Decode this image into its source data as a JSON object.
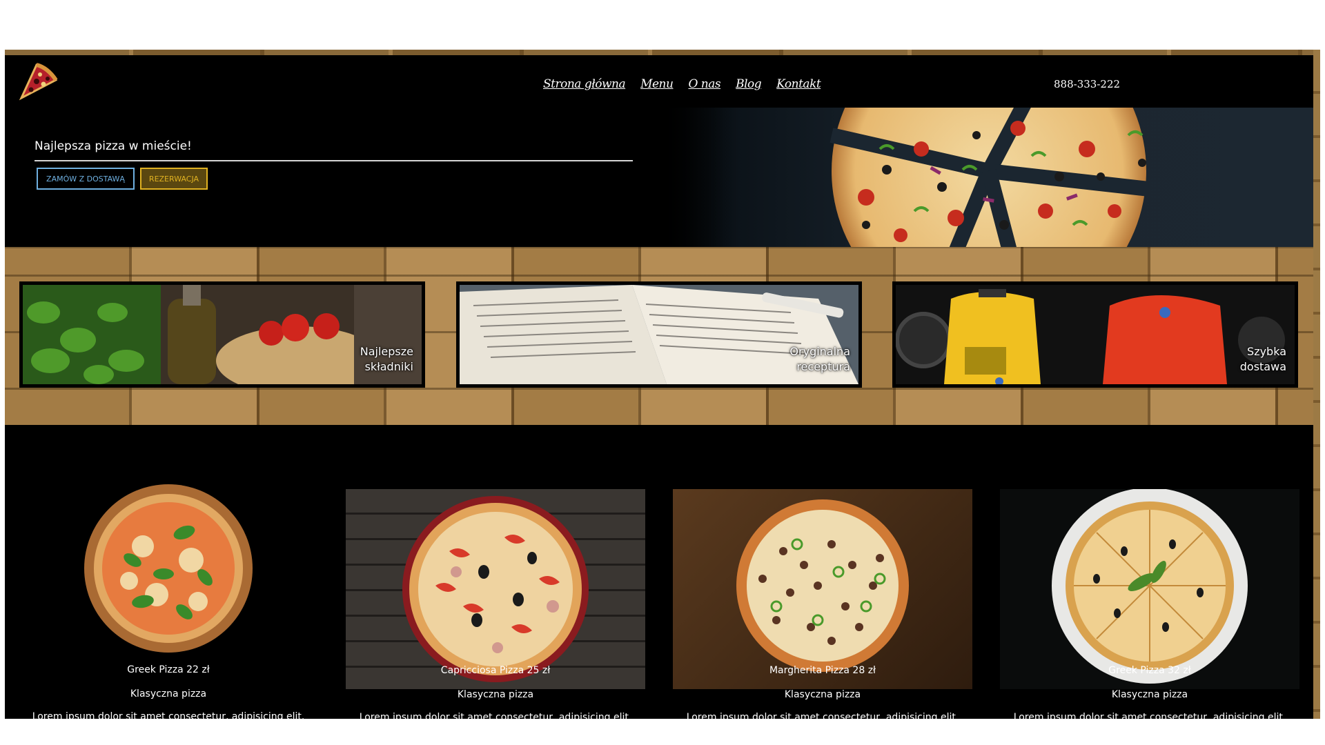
{
  "header": {
    "nav": [
      "Strona główna",
      "Menu",
      "O nas",
      "Blog",
      "Kontakt"
    ],
    "phone": "888-333-222"
  },
  "hero": {
    "title": "Najlepsza pizza w mieście!",
    "order_button": "ZAMÓW Z DOSTAWĄ",
    "reserve_button": "REZERWACJA"
  },
  "features": [
    {
      "label_line1": "Najlepsze",
      "label_line2": "składniki"
    },
    {
      "label_line1": "Oryginalna",
      "label_line2": "receptura"
    },
    {
      "label_line1": "Szybka",
      "label_line2": "dostawa"
    }
  ],
  "menu": [
    {
      "name": "Greek Pizza 22 zł",
      "type": "Klasyczna pizza",
      "desc": "Lorem ipsum dolor sit amet consectetur, adipisicing elit. Soluta, aliquid?"
    },
    {
      "name": "Capricciosa Pizza 25 zł",
      "type": "Klasyczna pizza",
      "desc": "Lorem ipsum dolor sit amet consectetur, adipisicing elit. Soluta, aliquid?"
    },
    {
      "name": "Margherita Pizza 28 zł",
      "type": "Klasyczna pizza",
      "desc": "Lorem ipsum dolor sit amet consectetur, adipisicing elit. Soluta, aliquid?"
    },
    {
      "name": "Greek Pizza 32 zł",
      "type": "Klasyczna pizza",
      "desc": "Lorem ipsum dolor sit amet consectetur, adipisicing elit. Soluta, aliquid?"
    }
  ],
  "colors": {
    "order_button": "#6fb0e0",
    "reserve_button": "#e0b222",
    "background": "#000000"
  },
  "icons": [
    "pizza-slice-logo-icon"
  ]
}
